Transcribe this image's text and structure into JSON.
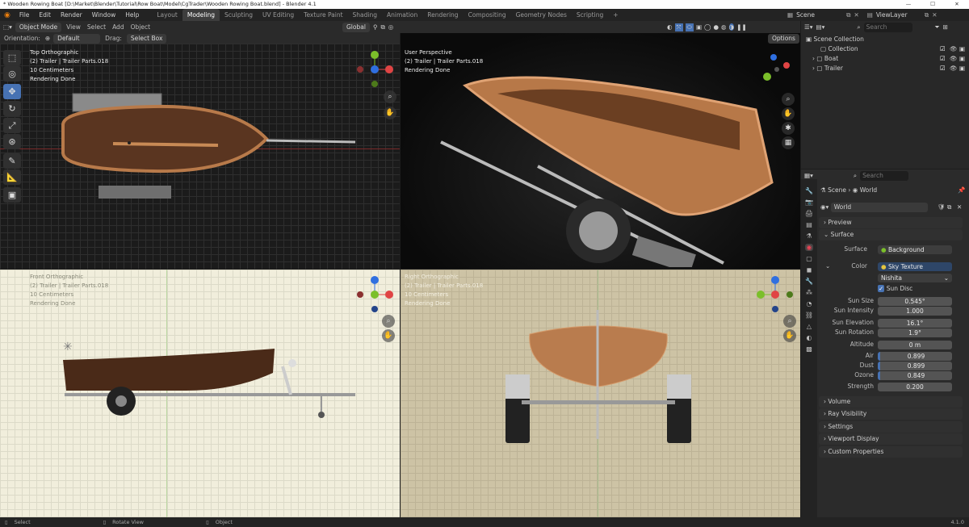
{
  "window": {
    "title": "* Wooden Rowing Boat [D:\\Market\\Blender\\Tutorial\\Row Boat\\Model\\CgTrader\\Wooden Rowing Boat.blend] - Blender 4.1",
    "minimize": "—",
    "maximize": "☐",
    "close": "✕"
  },
  "menu": [
    "File",
    "Edit",
    "Render",
    "Window",
    "Help"
  ],
  "workspaces": [
    "Layout",
    "Modeling",
    "Sculpting",
    "UV Editing",
    "Texture Paint",
    "Shading",
    "Animation",
    "Rendering",
    "Compositing",
    "Geometry Nodes",
    "Scripting"
  ],
  "active_workspace": "Modeling",
  "scene_name": "Scene",
  "view_layer": "ViewLayer",
  "viewport_toolbar": {
    "mode": "Object Mode",
    "menus": [
      "View",
      "Select",
      "Add",
      "Object"
    ],
    "orientation_global": "Global",
    "options": "Options"
  },
  "ortho_bar": {
    "orientation_label": "Orientation:",
    "orientation": "Default",
    "drag_label": "Drag:",
    "drag": "Select Box"
  },
  "viewports": {
    "top": {
      "lines": [
        "Top Orthographic",
        "(2) Trailer | Trailer Parts.018",
        "10 Centimeters",
        "Rendering Done"
      ]
    },
    "persp": {
      "lines": [
        "User Perspective",
        "(2) Trailer | Trailer Parts.018",
        "Rendering Done"
      ]
    },
    "front": {
      "lines": [
        "Front Orthographic",
        "(2) Trailer | Trailer Parts.018",
        "10 Centimeters",
        "Rendering Done"
      ]
    },
    "right": {
      "lines": [
        "Right Orthographic",
        "(2) Trailer | Trailer Parts.018",
        "10 Centimeters",
        "Rendering Done"
      ]
    }
  },
  "gizmo_axes": {
    "x": "X",
    "y": "Y",
    "z": "Z"
  },
  "outliner": {
    "search_placeholder": "Search",
    "root": "Scene Collection",
    "items": [
      "Collection",
      "Boat",
      "Trailer"
    ]
  },
  "properties": {
    "search_placeholder": "Search",
    "breadcrumb": [
      "Scene",
      "World"
    ],
    "world_name": "World",
    "panels_top": [
      "Preview",
      "Surface"
    ],
    "surface_label": "Surface",
    "surface_value": "Background",
    "color_label": "Color",
    "color_value": "Sky Texture",
    "sky_type": "Nishita",
    "sun_disc": "Sun Disc",
    "fields": [
      {
        "label": "Sun Size",
        "value": "0.545°"
      },
      {
        "label": "Sun Intensity",
        "value": "1.000"
      },
      {
        "label": "Sun Elevation",
        "value": "16.1°"
      },
      {
        "label": "Sun Rotation",
        "value": "1.9°"
      },
      {
        "label": "Altitude",
        "value": "0 m"
      },
      {
        "label": "Air",
        "value": "0.899"
      },
      {
        "label": "Dust",
        "value": "0.899"
      },
      {
        "label": "Ozone",
        "value": "0.849"
      },
      {
        "label": "Strength",
        "value": "0.200"
      }
    ],
    "panels_bottom": [
      "Volume",
      "Ray Visibility",
      "Settings",
      "Viewport Display",
      "Custom Properties"
    ]
  },
  "status": {
    "select": "Select",
    "rotate": "Rotate View",
    "object": "Object",
    "version": "4.1.0"
  },
  "colors": {
    "accent": "#4772b3",
    "axis_x": "#e04444",
    "axis_y": "#7bbf2a",
    "axis_z": "#2f6fe0"
  }
}
